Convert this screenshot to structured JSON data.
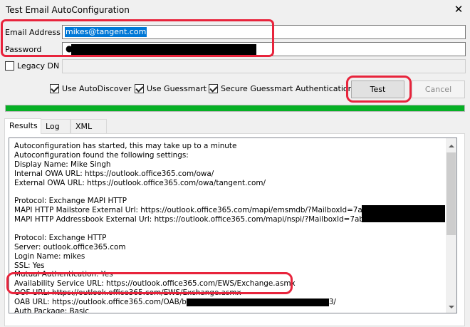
{
  "window": {
    "title": "Test Email AutoConfiguration",
    "close_glyph": "✕"
  },
  "form": {
    "email_label": "Email Address",
    "email_value": "mikes@tangent.com",
    "password_label": "Password",
    "password_dots": "●",
    "legacy_dn_label": "Legacy DN",
    "legacy_dn_checked": false,
    "legacy_dn_value": ""
  },
  "options": {
    "use_autodiscover_label": "Use AutoDiscover",
    "use_autodiscover_checked": true,
    "use_guessmart_label": "Use Guessmart",
    "use_guessmart_checked": true,
    "secure_guessmart_label": "Secure Guessmart Authentication",
    "secure_guessmart_checked": true
  },
  "buttons": {
    "test_label": "Test",
    "cancel_label": "Cancel"
  },
  "progress": {
    "percent": 100,
    "color": "#06b025"
  },
  "tabs": [
    {
      "label": "Results",
      "active": true
    },
    {
      "label": "Log",
      "active": false
    },
    {
      "label": "XML",
      "active": false
    }
  ],
  "results": {
    "lines": [
      "Autoconfiguration has started, this may take up to a minute",
      "Autoconfiguration found the following settings:",
      "Display Name: Mike Singh",
      "Internal OWA URL: https://outlook.office365.com/owa/",
      "External OWA URL: https://outlook.office365.com/owa/tangent.com/",
      "",
      "Protocol: Exchange MAPI HTTP",
      "MAPI HTTP Mailstore External Url: https://outlook.office365.com/mapi/emsmdb/?MailboxId=7ab9",
      "MAPI HTTP Addressbook External Url: https://outlook.office365.com/mapi/nspi/?MailboxId=7ab9",
      "",
      "Protocol: Exchange HTTP",
      "Server: outlook.office365.com",
      "Login Name: mikes",
      "SSL: Yes",
      "Mutual Authentication: Yes",
      "Availability Service URL: https://outlook.office365.com/EWS/Exchange.asmx",
      "OOF URL: https://outlook.office365.com/EWS/Exchange.asmx",
      "OAB URL: https://outlook.office365.com/OAB/b",
      "Auth Package: Basic"
    ],
    "oab_suffix": "3/"
  },
  "colors": {
    "highlight": "#e8243c",
    "selection": "#0078d7"
  }
}
